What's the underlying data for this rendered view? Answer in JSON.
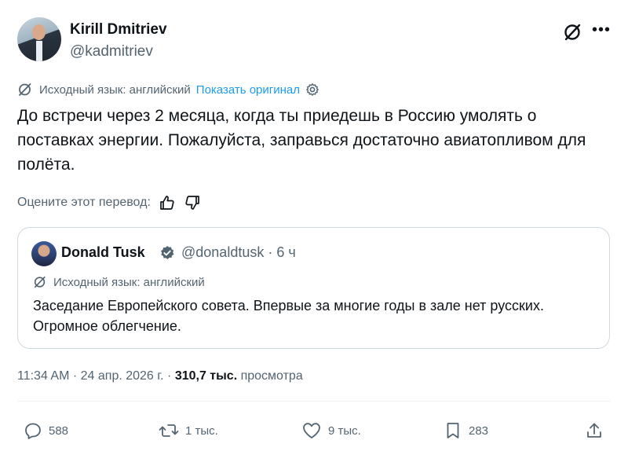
{
  "author": {
    "name": "Kirill Dmitriev",
    "handle": "@kadmitriev"
  },
  "translation": {
    "source_label": "Исходный язык: английский",
    "show_original": "Показать оригинал"
  },
  "tweet": {
    "text": "До встречи через 2 месяца, когда ты приедешь в Россию умолять о поставках энергии. Пожалуйста, заправься достаточно авиатопливом для полёта."
  },
  "rating": {
    "label": "Оцените этот перевод:"
  },
  "quoted": {
    "name": "Donald Tusk",
    "handle_time": "@donaldtusk · 6 ч",
    "source_label": "Исходный язык: английский",
    "text": "Заседание Европейского совета. Впервые за многие годы в зале нет русских. Огромное облегчение."
  },
  "meta": {
    "time_date": "11:34 AM · 24 апр. 2026 г. · ",
    "views_count": "310,7 тыс.",
    "views_label": " просмотра"
  },
  "actions": {
    "replies": "588",
    "reposts": "1 тыс.",
    "likes": "9 тыс.",
    "bookmarks": "283"
  },
  "icons": {
    "grok": "grok-icon",
    "more": "more-icon",
    "translate": "translate-icon",
    "gear": "gear-icon",
    "thumbs_up": "thumbs-up-icon",
    "thumbs_down": "thumbs-down-icon",
    "verified": "verified-badge-icon",
    "reply": "reply-icon",
    "repost": "repost-icon",
    "like": "like-icon",
    "bookmark": "bookmark-icon",
    "share": "share-icon"
  },
  "colors": {
    "accent": "#1d9bf0",
    "text": "#0f1419",
    "secondary": "#536471",
    "border": "#cfd9de"
  }
}
